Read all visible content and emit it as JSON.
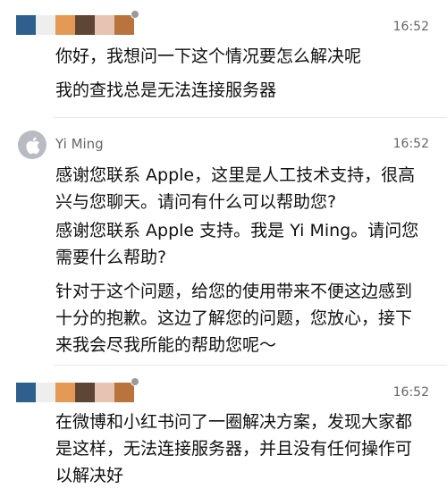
{
  "conversation": [
    {
      "sender": "user",
      "time": "16:52",
      "messages": [
        "你好，我想问一下这个情况要怎么解决呢",
        "我的查找总是无法连接服务器"
      ]
    },
    {
      "sender": "agent",
      "name": "Yi Ming",
      "avatar_icon": "apple-logo-icon",
      "time": "16:52",
      "messages": [
        "感谢您联系 Apple，这里是人工技术支持，很高兴与您聊天。请问有什么可以帮助您?",
        "感谢您联系 Apple 支持。我是 Yi Ming。请问您需要什么帮助?",
        "针对于这个问题，给您的使用带来不便这边感到十分的抱歉。这边了解您的问题，您放心，接下来我会尽我所能的帮助您呢～"
      ]
    },
    {
      "sender": "user",
      "time": "16:52",
      "messages": [
        "在微博和小红书问了一圈解决方案，发现大家都是这样，无法连接服务器，并且没有任何操作可以解决好"
      ]
    }
  ],
  "colors": {
    "redaction_pixels": [
      "#2e5f8f",
      "#eeeeee",
      "#e49a55",
      "#5d4636",
      "#e6c3b2",
      "#b8743c"
    ],
    "apple_avatar_bg": "#b7bbc2",
    "timestamp": "#666666",
    "separator": "#e6e6e6"
  }
}
